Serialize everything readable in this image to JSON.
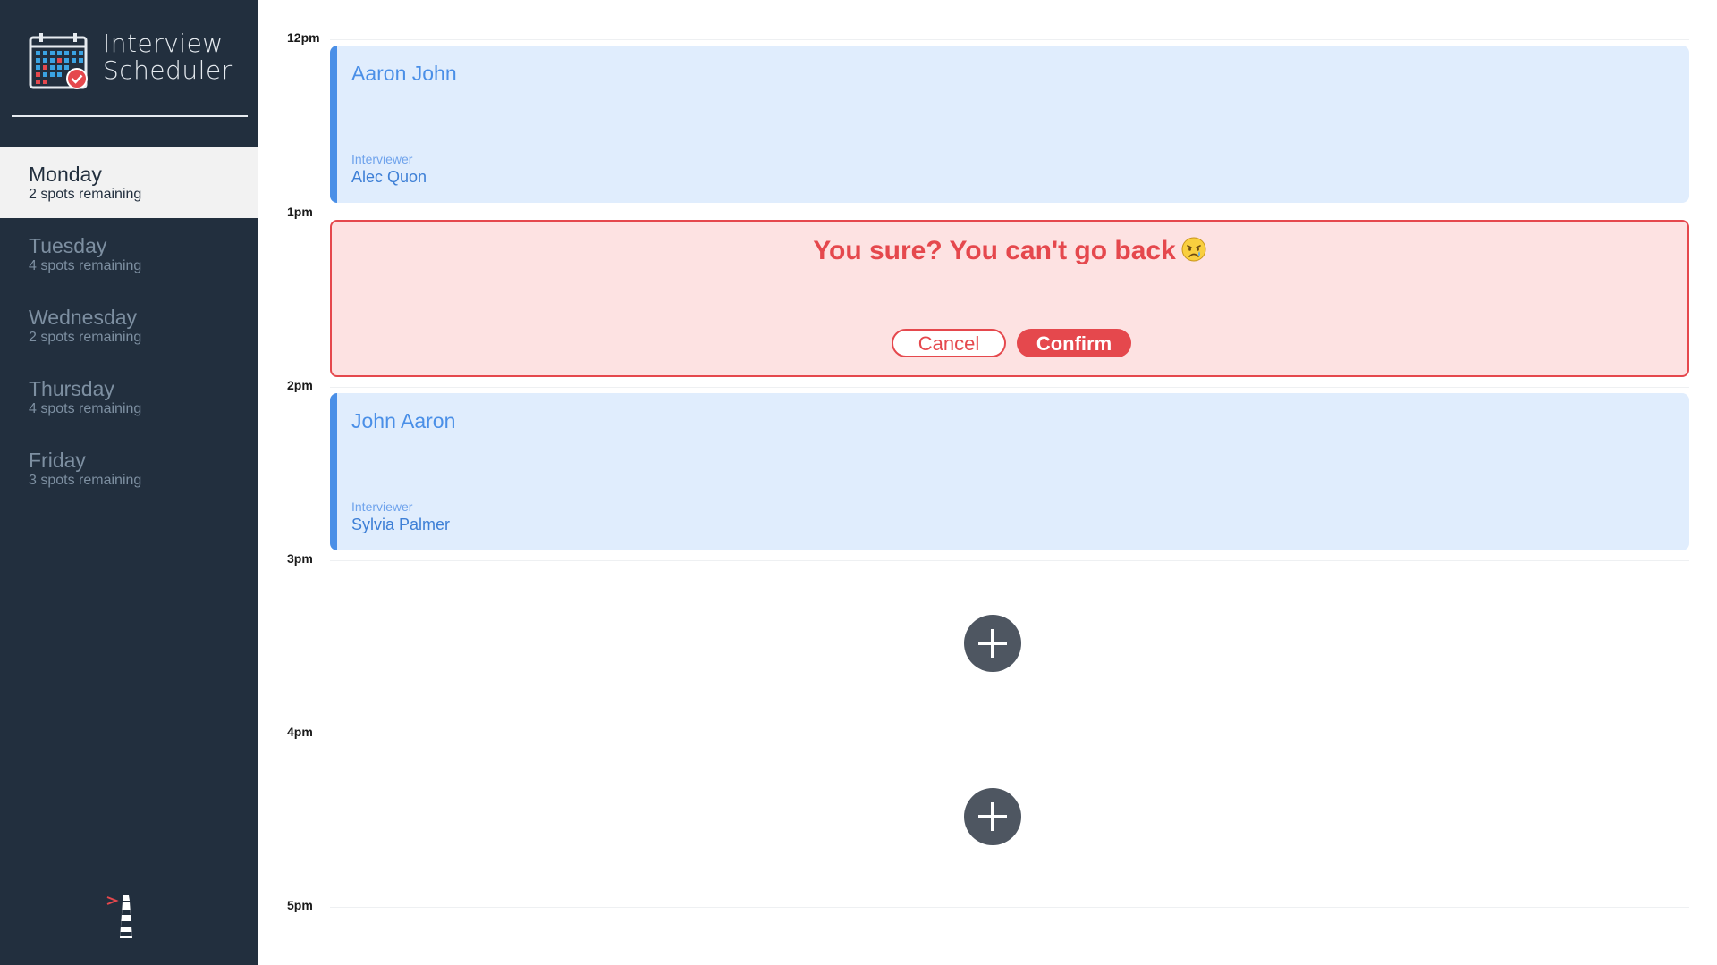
{
  "app": {
    "brand_line1": "Interview",
    "brand_line2": "Scheduler"
  },
  "sidebar": {
    "days": [
      {
        "name": "Monday",
        "spots": "2 spots remaining",
        "selected": true
      },
      {
        "name": "Tuesday",
        "spots": "4 spots remaining",
        "selected": false
      },
      {
        "name": "Wednesday",
        "spots": "2 spots remaining",
        "selected": false
      },
      {
        "name": "Thursday",
        "spots": "4 spots remaining",
        "selected": false
      },
      {
        "name": "Friday",
        "spots": "3 spots remaining",
        "selected": false
      }
    ],
    "footer_logo": "lighthouse-icon"
  },
  "schedule": {
    "slots": [
      {
        "time": "12pm",
        "type": "appointment",
        "student": "Aaron John",
        "interviewer_label": "Interviewer",
        "interviewer": "Alec Quon"
      },
      {
        "time": "1pm",
        "type": "confirm",
        "message": "You sure? You can't go back",
        "emoji": "crying-face",
        "cancel_label": "Cancel",
        "confirm_label": "Confirm"
      },
      {
        "time": "2pm",
        "type": "appointment",
        "student": "John Aaron",
        "interviewer_label": "Interviewer",
        "interviewer": "Sylvia Palmer"
      },
      {
        "time": "3pm",
        "type": "empty",
        "add_icon": "plus-icon"
      },
      {
        "time": "4pm",
        "type": "empty",
        "add_icon": "plus-icon"
      },
      {
        "time": "5pm",
        "type": "last"
      }
    ]
  },
  "colors": {
    "sidebar_bg": "#222f3e",
    "selected_bg": "#f2f2f2",
    "appointment_bg": "#e0edfd",
    "appointment_accent": "#4a8fe7",
    "confirm_bg": "#fde2e2",
    "danger": "#e5484d",
    "add_button": "#4e5661"
  }
}
